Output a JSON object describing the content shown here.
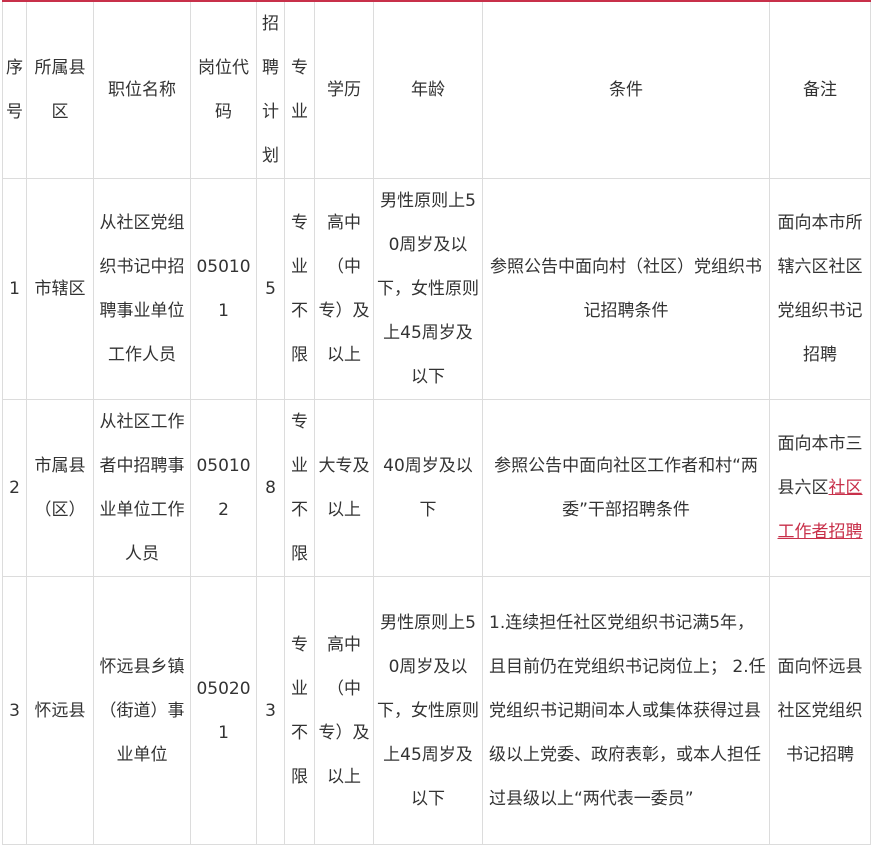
{
  "headers": {
    "seq": "序号",
    "county": "所属县区",
    "position": "职位名称",
    "code": "岗位代码",
    "plan": "招聘计划",
    "major": "专业",
    "education": "学历",
    "age": "年龄",
    "conditions": "条件",
    "remarks": "备注"
  },
  "rows": [
    {
      "seq": "1",
      "county": "市辖区",
      "position": "从社区党组织书记中招聘事业单位工作人员",
      "code": "050101",
      "plan": "5",
      "major": "专业不限",
      "education": "高中（中专）及以上",
      "age": "男性原则上50周岁及以下，女性原则上45周岁及以下",
      "conditions": "参照公告中面向村（社区）党组织书记招聘条件",
      "remarks": "面向本市所辖六区社区党组织书记招聘"
    },
    {
      "seq": "2",
      "county": "市属县（区）",
      "position": "从社区工作者中招聘事业单位工作人员",
      "code": "050102",
      "plan": "8",
      "major": "专业不限",
      "education": "大专及以上",
      "age": "40周岁及以下",
      "conditions": "参照公告中面向社区工作者和村“两委”干部招聘条件",
      "remarks_prefix": "面向本市三县六区",
      "remarks_link": "社区工作者招聘"
    },
    {
      "seq": "3",
      "county": "怀远县",
      "position": "怀远县乡镇（街道）事业单位",
      "code": "050201",
      "plan": "3",
      "major": "专业不限",
      "education": "高中（中专）及以上",
      "age": "男性原则上50周岁及以下，女性原则上45周岁及以下",
      "conditions": "1.连续担任社区党组织书记满5年，且目前仍在党组织书记岗位上； 2.任党组织书记期间本人或集体获得过县级以上党委、政府表彰，或本人担任过县级以上“两代表一委员”",
      "remarks": "面向怀远县社区党组织书记招聘"
    }
  ]
}
